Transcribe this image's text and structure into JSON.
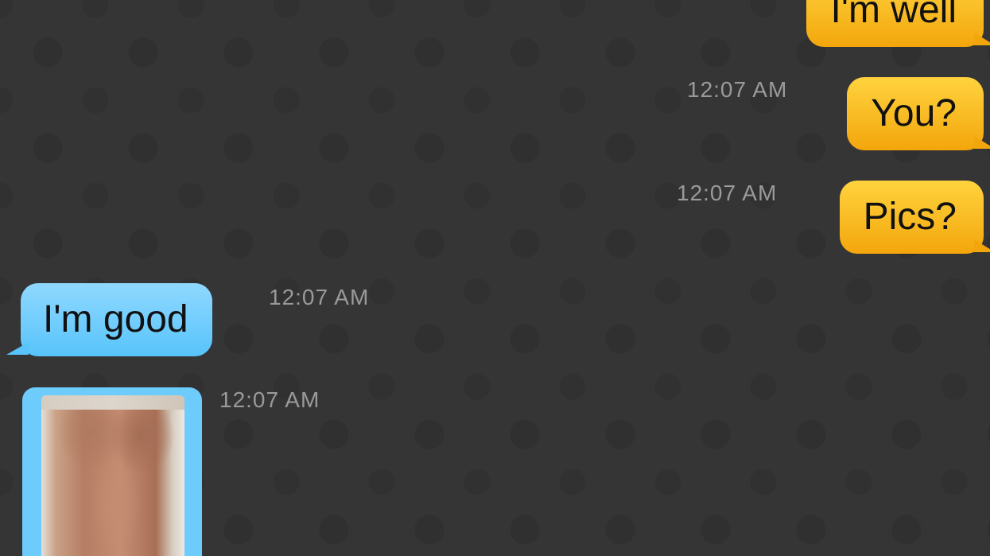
{
  "messages": [
    {
      "direction": "outgoing",
      "text": "I'm well",
      "time": ""
    },
    {
      "direction": "outgoing",
      "text": "You?",
      "time": "12:07 AM"
    },
    {
      "direction": "outgoing",
      "text": "Pics?",
      "time": "12:07 AM"
    },
    {
      "direction": "incoming",
      "text": "I'm good",
      "time": "12:07 AM"
    },
    {
      "direction": "incoming",
      "type": "photo",
      "time": "12:07 AM"
    }
  ],
  "colors": {
    "background": "#353535",
    "outgoing_bubble": "#f8bb22",
    "incoming_bubble": "#6dccfb",
    "timestamp": "#9a9a9a"
  }
}
